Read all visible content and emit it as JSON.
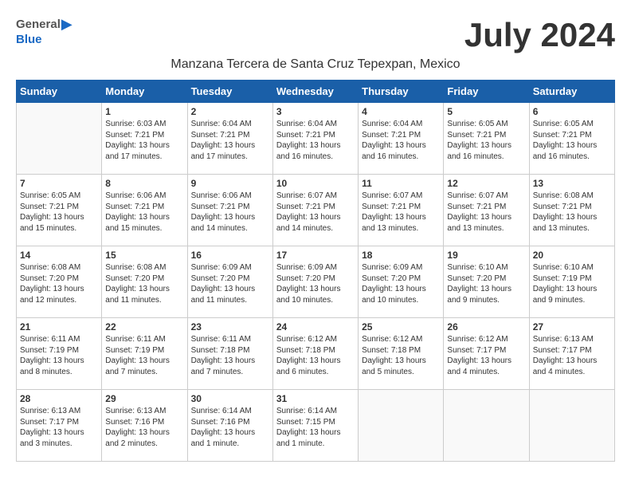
{
  "header": {
    "logo": {
      "general": "General",
      "blue": "Blue",
      "icon": "▶"
    },
    "month_title": "July 2024",
    "subtitle": "Manzana Tercera de Santa Cruz Tepexpan, Mexico"
  },
  "weekdays": [
    "Sunday",
    "Monday",
    "Tuesday",
    "Wednesday",
    "Thursday",
    "Friday",
    "Saturday"
  ],
  "weeks": [
    [
      {
        "day": "",
        "info": ""
      },
      {
        "day": "1",
        "info": "Sunrise: 6:03 AM\nSunset: 7:21 PM\nDaylight: 13 hours\nand 17 minutes."
      },
      {
        "day": "2",
        "info": "Sunrise: 6:04 AM\nSunset: 7:21 PM\nDaylight: 13 hours\nand 17 minutes."
      },
      {
        "day": "3",
        "info": "Sunrise: 6:04 AM\nSunset: 7:21 PM\nDaylight: 13 hours\nand 16 minutes."
      },
      {
        "day": "4",
        "info": "Sunrise: 6:04 AM\nSunset: 7:21 PM\nDaylight: 13 hours\nand 16 minutes."
      },
      {
        "day": "5",
        "info": "Sunrise: 6:05 AM\nSunset: 7:21 PM\nDaylight: 13 hours\nand 16 minutes."
      },
      {
        "day": "6",
        "info": "Sunrise: 6:05 AM\nSunset: 7:21 PM\nDaylight: 13 hours\nand 16 minutes."
      }
    ],
    [
      {
        "day": "7",
        "info": "Sunrise: 6:05 AM\nSunset: 7:21 PM\nDaylight: 13 hours\nand 15 minutes."
      },
      {
        "day": "8",
        "info": "Sunrise: 6:06 AM\nSunset: 7:21 PM\nDaylight: 13 hours\nand 15 minutes."
      },
      {
        "day": "9",
        "info": "Sunrise: 6:06 AM\nSunset: 7:21 PM\nDaylight: 13 hours\nand 14 minutes."
      },
      {
        "day": "10",
        "info": "Sunrise: 6:07 AM\nSunset: 7:21 PM\nDaylight: 13 hours\nand 14 minutes."
      },
      {
        "day": "11",
        "info": "Sunrise: 6:07 AM\nSunset: 7:21 PM\nDaylight: 13 hours\nand 13 minutes."
      },
      {
        "day": "12",
        "info": "Sunrise: 6:07 AM\nSunset: 7:21 PM\nDaylight: 13 hours\nand 13 minutes."
      },
      {
        "day": "13",
        "info": "Sunrise: 6:08 AM\nSunset: 7:21 PM\nDaylight: 13 hours\nand 13 minutes."
      }
    ],
    [
      {
        "day": "14",
        "info": "Sunrise: 6:08 AM\nSunset: 7:20 PM\nDaylight: 13 hours\nand 12 minutes."
      },
      {
        "day": "15",
        "info": "Sunrise: 6:08 AM\nSunset: 7:20 PM\nDaylight: 13 hours\nand 11 minutes."
      },
      {
        "day": "16",
        "info": "Sunrise: 6:09 AM\nSunset: 7:20 PM\nDaylight: 13 hours\nand 11 minutes."
      },
      {
        "day": "17",
        "info": "Sunrise: 6:09 AM\nSunset: 7:20 PM\nDaylight: 13 hours\nand 10 minutes."
      },
      {
        "day": "18",
        "info": "Sunrise: 6:09 AM\nSunset: 7:20 PM\nDaylight: 13 hours\nand 10 minutes."
      },
      {
        "day": "19",
        "info": "Sunrise: 6:10 AM\nSunset: 7:20 PM\nDaylight: 13 hours\nand 9 minutes."
      },
      {
        "day": "20",
        "info": "Sunrise: 6:10 AM\nSunset: 7:19 PM\nDaylight: 13 hours\nand 9 minutes."
      }
    ],
    [
      {
        "day": "21",
        "info": "Sunrise: 6:11 AM\nSunset: 7:19 PM\nDaylight: 13 hours\nand 8 minutes."
      },
      {
        "day": "22",
        "info": "Sunrise: 6:11 AM\nSunset: 7:19 PM\nDaylight: 13 hours\nand 7 minutes."
      },
      {
        "day": "23",
        "info": "Sunrise: 6:11 AM\nSunset: 7:18 PM\nDaylight: 13 hours\nand 7 minutes."
      },
      {
        "day": "24",
        "info": "Sunrise: 6:12 AM\nSunset: 7:18 PM\nDaylight: 13 hours\nand 6 minutes."
      },
      {
        "day": "25",
        "info": "Sunrise: 6:12 AM\nSunset: 7:18 PM\nDaylight: 13 hours\nand 5 minutes."
      },
      {
        "day": "26",
        "info": "Sunrise: 6:12 AM\nSunset: 7:17 PM\nDaylight: 13 hours\nand 4 minutes."
      },
      {
        "day": "27",
        "info": "Sunrise: 6:13 AM\nSunset: 7:17 PM\nDaylight: 13 hours\nand 4 minutes."
      }
    ],
    [
      {
        "day": "28",
        "info": "Sunrise: 6:13 AM\nSunset: 7:17 PM\nDaylight: 13 hours\nand 3 minutes."
      },
      {
        "day": "29",
        "info": "Sunrise: 6:13 AM\nSunset: 7:16 PM\nDaylight: 13 hours\nand 2 minutes."
      },
      {
        "day": "30",
        "info": "Sunrise: 6:14 AM\nSunset: 7:16 PM\nDaylight: 13 hours\nand 1 minute."
      },
      {
        "day": "31",
        "info": "Sunrise: 6:14 AM\nSunset: 7:15 PM\nDaylight: 13 hours\nand 1 minute."
      },
      {
        "day": "",
        "info": ""
      },
      {
        "day": "",
        "info": ""
      },
      {
        "day": "",
        "info": ""
      }
    ]
  ]
}
